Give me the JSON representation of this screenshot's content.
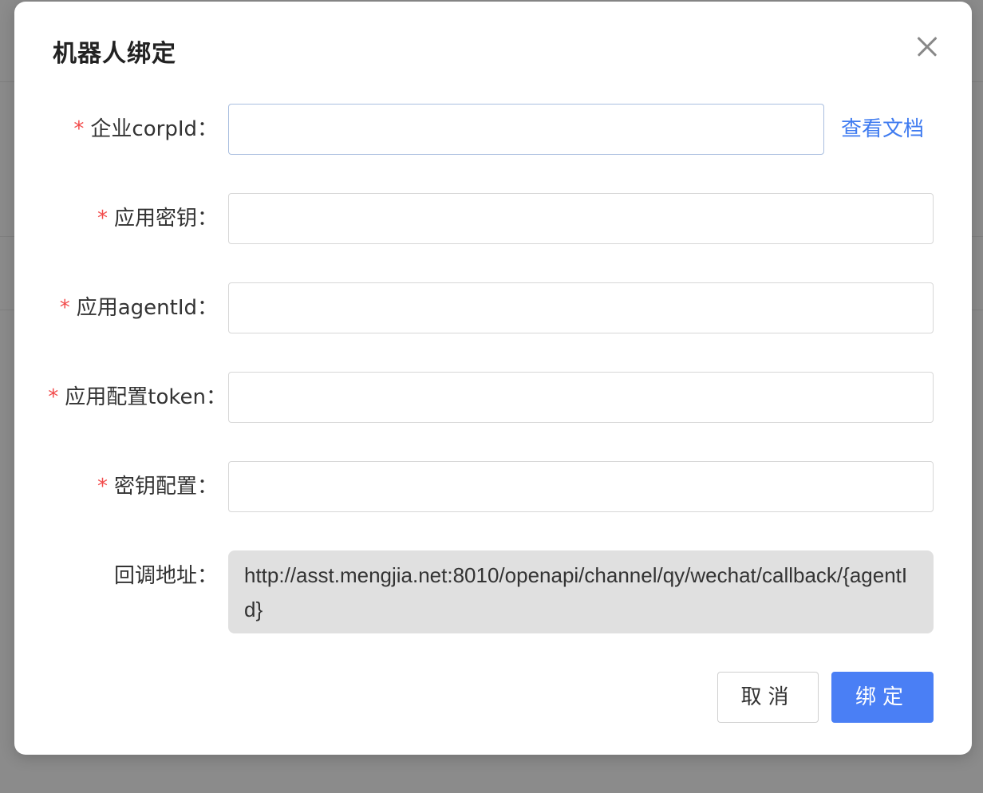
{
  "dialog": {
    "title": "机器人绑定",
    "close_icon": "close-icon"
  },
  "form": {
    "corp_id": {
      "required_mark": "*",
      "label": "企业corpId：",
      "value": "",
      "placeholder": "",
      "doc_link": "查看文档"
    },
    "app_secret": {
      "required_mark": "*",
      "label": "应用密钥：",
      "value": "",
      "placeholder": ""
    },
    "agent_id": {
      "required_mark": "*",
      "label": "应用agentId：",
      "value": "",
      "placeholder": ""
    },
    "token": {
      "required_mark": "*",
      "label": "应用配置token：",
      "value": "",
      "placeholder": ""
    },
    "key_config": {
      "required_mark": "*",
      "label": "密钥配置：",
      "value": "",
      "placeholder": ""
    },
    "callback": {
      "label": "回调地址：",
      "value": "http://asst.mengjia.net:8010/openapi/channel/qy/wechat/callback/{agentId}"
    }
  },
  "footer": {
    "cancel_label": "取消",
    "bind_label": "绑定"
  },
  "colors": {
    "primary": "#4a7ff5",
    "link": "#3f7bf0",
    "required": "#f24b4b",
    "mask": "#8b8b8b",
    "readonly_bg": "#e0e0e0"
  }
}
